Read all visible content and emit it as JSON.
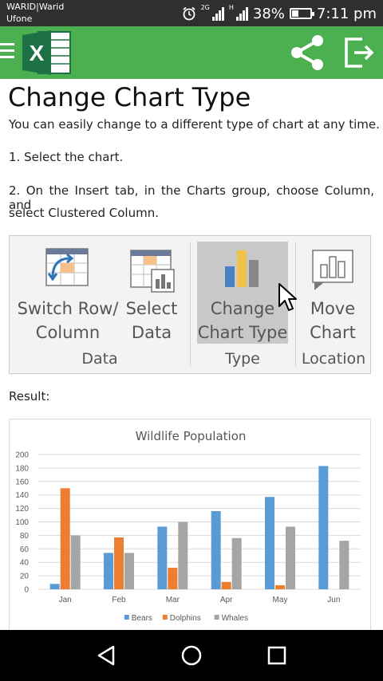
{
  "status": {
    "carrier_line1": "WARID|Warid",
    "carrier_line2": "Ufone",
    "network_2g": "2G",
    "network_h": "H",
    "battery": "38%",
    "battery_level": 0.38,
    "time": "7:11 pm"
  },
  "appbar": {
    "logo_letter": "X",
    "icons": [
      "menu-icon",
      "excel-logo",
      "share-icon",
      "exit-icon"
    ]
  },
  "article": {
    "title": "Change Chart Type",
    "intro": "You can easily change to a different type of chart at any time.",
    "step1": "1. Select the chart.",
    "step2_line1": "2. On the Insert tab, in the Charts group, choose Column, and",
    "step2_line2": "select Clustered Column.",
    "result_label": "Result:"
  },
  "ribbon": {
    "switch_line1": "Switch Row/",
    "switch_line2": "Column",
    "select_line1": "Select",
    "select_line2": "Data",
    "change_line1": "Change",
    "change_line2": "Chart Type",
    "move_line1": "Move",
    "move_line2": "Chart",
    "group_data": "Data",
    "group_type": "Type",
    "group_location": "Location"
  },
  "chart_data": {
    "type": "bar",
    "title": "Wildlife Population",
    "categories": [
      "Jan",
      "Feb",
      "Mar",
      "Apr",
      "May",
      "Jun"
    ],
    "series": [
      {
        "name": "Bears",
        "values": [
          8,
          54,
          93,
          116,
          137,
          183
        ],
        "color": "#5b9bd5"
      },
      {
        "name": "Dolphins",
        "values": [
          150,
          77,
          32,
          11,
          6,
          0
        ],
        "color": "#ed7d31"
      },
      {
        "name": "Whales",
        "values": [
          80,
          54,
          100,
          76,
          93,
          72
        ],
        "color": "#a5a5a5"
      }
    ],
    "yticks": [
      "0",
      "20",
      "40",
      "60",
      "80",
      "100",
      "120",
      "140",
      "160",
      "180",
      "200"
    ],
    "ylim": [
      0,
      200
    ],
    "grid": true,
    "legend": "bottom"
  }
}
